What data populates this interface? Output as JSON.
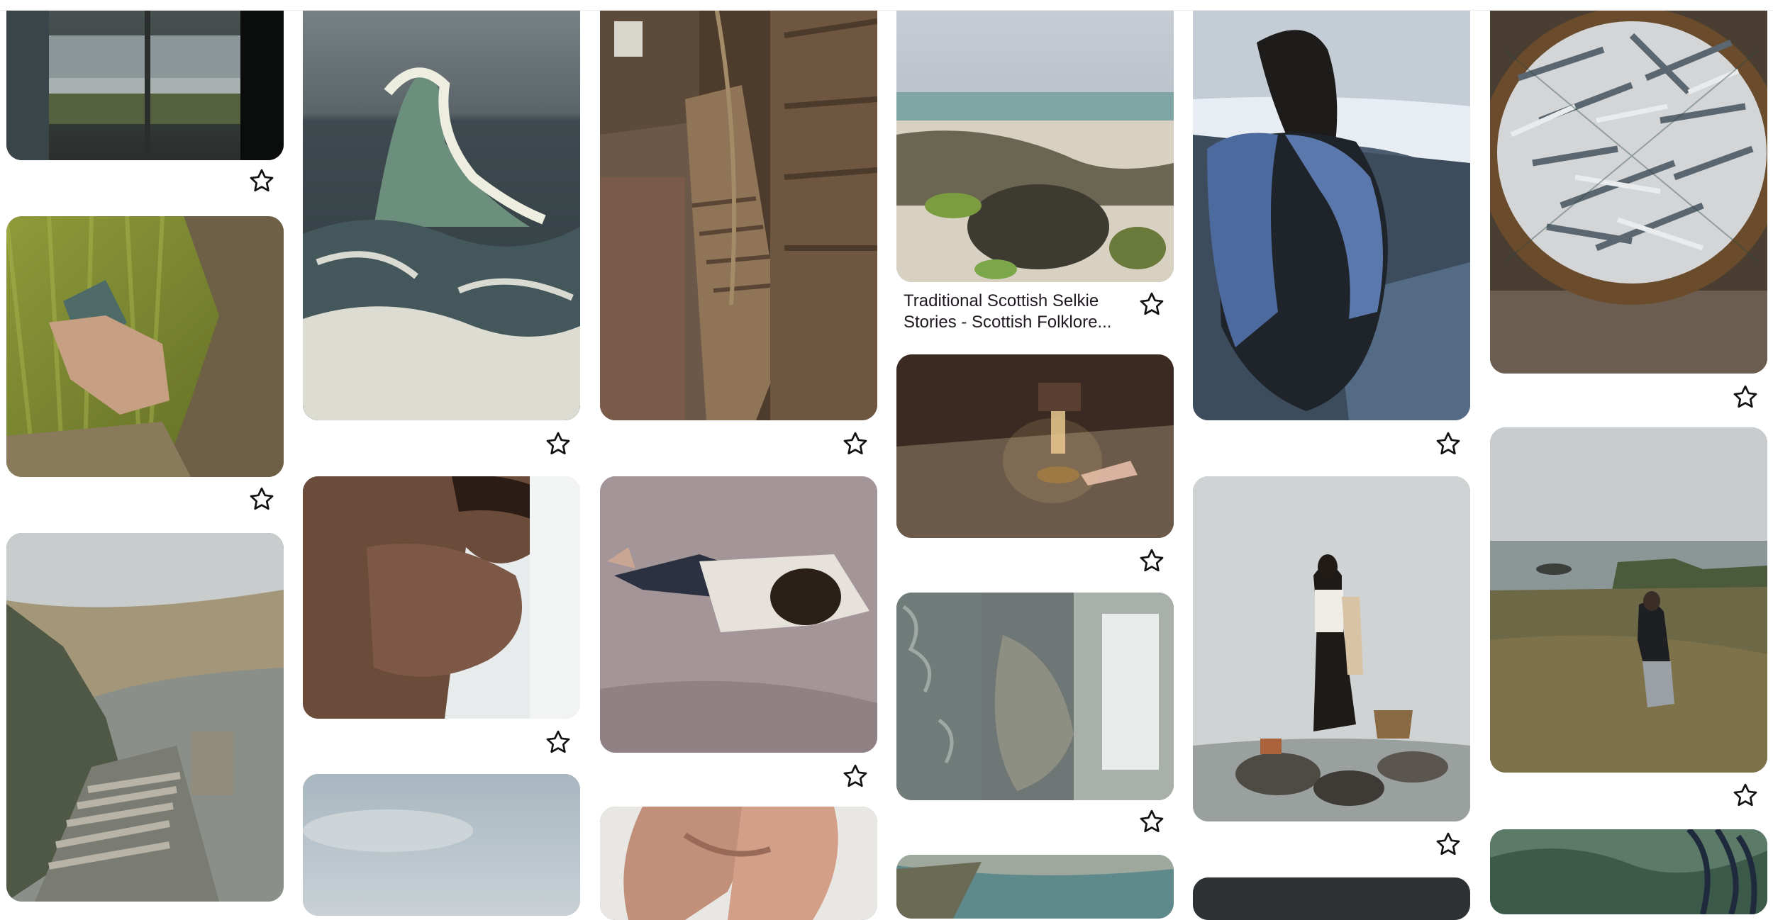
{
  "feed": {
    "pins": [
      {
        "id": "window-coast",
        "saved": false
      },
      {
        "id": "hand-card-grass",
        "saved": false
      },
      {
        "id": "cliff-stairs",
        "saved": false
      },
      {
        "id": "stormy-wave",
        "saved": false
      },
      {
        "id": "man-face-hands",
        "saved": false
      },
      {
        "id": "cloudy-sky",
        "saved": false
      },
      {
        "id": "ship-interior-stairs",
        "saved": false
      },
      {
        "id": "man-on-wet-sand",
        "saved": false
      },
      {
        "id": "hand-at-throat",
        "saved": false
      },
      {
        "id": "rocky-beach",
        "saved": false,
        "title_line1": "Traditional Scottish Selkie",
        "title_line2": "Stories - Scottish Folklore..."
      },
      {
        "id": "oil-lamp-table",
        "saved": false
      },
      {
        "id": "lace-curtain",
        "saved": false
      },
      {
        "id": "coastal-landscape",
        "saved": false
      },
      {
        "id": "woman-blue-shawl-shore",
        "saved": false
      },
      {
        "id": "woman-with-basket-shore",
        "saved": false
      },
      {
        "id": "dark-partial",
        "saved": false
      },
      {
        "id": "basket-of-fish",
        "saved": false
      },
      {
        "id": "woman-walking-headland",
        "saved": false
      },
      {
        "id": "underwater-seaweed",
        "saved": false
      }
    ]
  },
  "icons": {
    "save": "star-outline-icon"
  },
  "colors": {
    "title_text": "#211922",
    "icon_stroke": "#111111"
  }
}
